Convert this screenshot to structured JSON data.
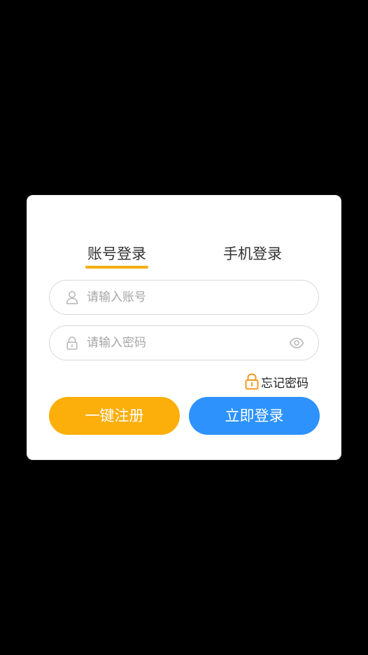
{
  "colors": {
    "accent": "#f5ae11",
    "register_button": "#fcae0a",
    "login_button": "#2d92fc",
    "backdrop": "#000000",
    "dialog": "#ffffff"
  },
  "tabs": [
    {
      "label": "账号登录",
      "active": true
    },
    {
      "label": "手机登录",
      "active": false
    }
  ],
  "account_field": {
    "placeholder": "请输入账号",
    "value": "",
    "icon": "user-icon"
  },
  "password_field": {
    "placeholder": "请输入密码",
    "value": "",
    "icon": "lock-icon",
    "toggle_icon": "eye-icon"
  },
  "forgot": {
    "label": "忘记密码",
    "icon": "unlock-icon"
  },
  "buttons": {
    "register": "一键注册",
    "login": "立即登录"
  }
}
